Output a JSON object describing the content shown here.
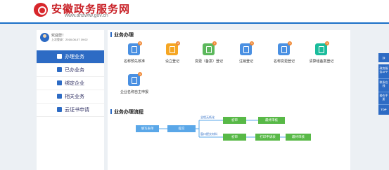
{
  "brand": {
    "title": "安徽政务服务网",
    "subtitle": "www.ahzwfw.gov.cn"
  },
  "user": {
    "welcome": "欢迎您！",
    "last_login": "上次登录：2018-08-07 19:02"
  },
  "menu": [
    {
      "label": "办理业务",
      "icon": "briefcase-icon",
      "active": true
    },
    {
      "label": "已办业务",
      "icon": "document-icon",
      "active": false
    },
    {
      "label": "绑定企业",
      "icon": "building-icon",
      "active": false
    },
    {
      "label": "相关业务",
      "icon": "list-icon",
      "active": false
    },
    {
      "label": "云证书申请",
      "icon": "certificate-icon",
      "active": false
    }
  ],
  "business": {
    "title": "业务办理",
    "items": [
      {
        "label": "名称预先核准",
        "badge": "5",
        "color": "#4a90e2",
        "icon": "edit-icon"
      },
      {
        "label": "设立登记",
        "badge": "4",
        "color": "#f5a623",
        "icon": "file-icon"
      },
      {
        "label": "变更（备案）登记",
        "badge": "1",
        "color": "#5cb85c",
        "icon": "edit-file-icon"
      },
      {
        "label": "注销登记",
        "badge": "1",
        "color": "#4a90e2",
        "icon": "cancel-file-icon"
      },
      {
        "label": "名称变更登记",
        "badge": "1",
        "color": "#4a90e2",
        "icon": "rename-icon"
      },
      {
        "label": "清算组备案登记",
        "badge": "1",
        "color": "#1abc9c",
        "icon": "register-icon"
      },
      {
        "label": "企业名称自主申报",
        "badge": "1",
        "color": "#4a90e2",
        "icon": "building-icon"
      }
    ]
  },
  "flow": {
    "title": "业务办理流程",
    "fill_form": "填写表单",
    "submit": "提交",
    "branch_top": "全程无纸化",
    "branch_bottom": "窗口提交材料",
    "review1": "初审",
    "final1": "最终审核",
    "review2": "初审",
    "print": "打印申请表",
    "final2": "最终审核"
  },
  "right_tools": {
    "expand": "»",
    "qr": "政务服务APP",
    "online": "联系在线",
    "manual": "操作手册",
    "top": "TOP"
  }
}
